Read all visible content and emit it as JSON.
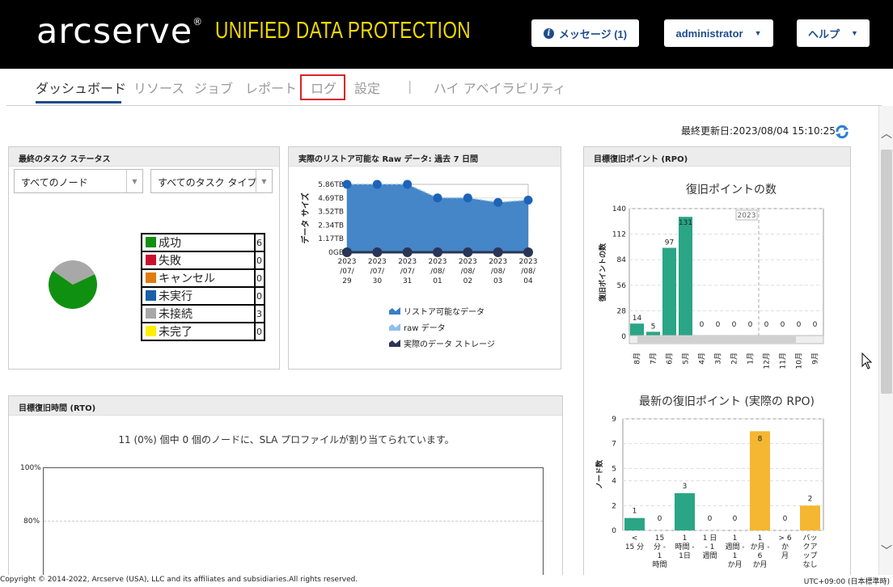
{
  "header": {
    "logo": "arcserve",
    "logo_mark": "®",
    "product": "UNIFIED DATA PROTECTION",
    "messages_label": "メッセージ (1)",
    "user_label": "administrator",
    "help_label": "ヘルプ",
    "colors": {
      "bar": "#000000",
      "product": "#f2d800",
      "button_text": "#1d4c8c"
    }
  },
  "nav": {
    "tabs": [
      {
        "label": "ダッシュボード",
        "active": true
      },
      {
        "label": "リソース"
      },
      {
        "label": "ジョブ"
      },
      {
        "label": "レポート"
      },
      {
        "label": "ログ",
        "highlighted": true
      },
      {
        "label": "設定"
      },
      {
        "label": "ハイ アベイラビリティ"
      }
    ],
    "separator": "|"
  },
  "last_updated": "最終更新日:2023/08/04 15:10:25",
  "task_status": {
    "title": "最終のタスク ステータス",
    "node_filter": "すべてのノード",
    "type_filter": "すべてのタスク タイプ",
    "legend": [
      {
        "label": "成功",
        "value": "6",
        "color": "#109010"
      },
      {
        "label": "失敗",
        "value": "0",
        "color": "#c8102e"
      },
      {
        "label": "キャンセル",
        "value": "0",
        "color": "#e07b10"
      },
      {
        "label": "未実行",
        "value": "0",
        "color": "#1a5fa8"
      },
      {
        "label": "未接続",
        "value": "3",
        "color": "#a8a8a8"
      },
      {
        "label": "未完了",
        "value": "0",
        "color": "#ffee00"
      }
    ]
  },
  "restore_data": {
    "title": "実際のリストア可能な Raw データ: 過去 7 日間",
    "ylabel": "データ サイズ",
    "legend": [
      {
        "label": "リストア可能なデータ",
        "color": "#3a7fc4"
      },
      {
        "label": "raw データ",
        "color": "#8fbfe8"
      },
      {
        "label": "実際のデータ ストレージ",
        "color": "#2b3555"
      }
    ]
  },
  "rto": {
    "title": "目標復旧時間 (RTO)",
    "message": "11 (0%) 個中 0 個のノードに、SLA プロファイルが割り当てられています。",
    "yticks": [
      "100%",
      "80%"
    ]
  },
  "rpo": {
    "title": "目標復旧ポイント (RPO)",
    "chart1_title": "復旧ポイントの数",
    "chart2_title": "最新の復旧ポイント (実際の RPO)"
  },
  "chart_data": [
    {
      "type": "pie",
      "categories": [
        "成功",
        "失敗",
        "キャンセル",
        "未実行",
        "未接続",
        "未完了"
      ],
      "values": [
        6,
        0,
        0,
        0,
        3,
        0
      ],
      "colors": [
        "#109010",
        "#c8102e",
        "#e07b10",
        "#1a5fa8",
        "#a8a8a8",
        "#ffee00"
      ]
    },
    {
      "type": "area",
      "title": "実際のリストア可能な Raw データ: 過去 7 日間",
      "ylabel": "データ サイズ",
      "x": [
        "2023/07/29",
        "2023/07/30",
        "2023/07/31",
        "2023/08/01",
        "2023/08/02",
        "2023/08/03",
        "2023/08/04"
      ],
      "yticks": [
        "0GB",
        "1.17TB",
        "2.34TB",
        "3.52TB",
        "4.69TB",
        "5.86TB"
      ],
      "ylim": [
        0,
        5.86
      ],
      "series": [
        {
          "name": "リストア可能なデータ",
          "values": [
            5.86,
            5.86,
            5.86,
            4.69,
            4.69,
            4.3,
            4.5
          ]
        },
        {
          "name": "raw データ",
          "values": [
            5.86,
            5.86,
            5.86,
            4.69,
            4.69,
            4.3,
            4.5
          ]
        },
        {
          "name": "実際のデータ ストレージ",
          "values": [
            0,
            0,
            0,
            0,
            0,
            0,
            0
          ]
        }
      ]
    },
    {
      "type": "bar",
      "title": "復旧ポイントの数",
      "ylabel": "復旧ポイントの数",
      "categories": [
        "8月",
        "7月",
        "6月",
        "5月",
        "4月",
        "3月",
        "2月",
        "1月",
        "12月",
        "11月",
        "10月",
        "9月"
      ],
      "values": [
        14,
        5,
        97,
        131,
        0,
        0,
        0,
        0,
        0,
        0,
        0,
        0
      ],
      "ylim": [
        0,
        140
      ],
      "yticks": [
        0,
        28,
        56,
        84,
        112,
        140
      ],
      "year_marker": "2023",
      "color": "#2aa586"
    },
    {
      "type": "bar",
      "title": "最新の復旧ポイント (実際の RPO)",
      "ylabel": "ノード数",
      "categories": [
        "< 15 分",
        "15 分 - 1 時間",
        "1 時間 - 1 日",
        "1 日 - 1 週間",
        "1 週間 - 1 か月",
        "1 か月 - 6 か月",
        "> 6 か月",
        "バックアップなし"
      ],
      "values": [
        1,
        0,
        3,
        0,
        0,
        8,
        0,
        2
      ],
      "ylim": [
        0,
        9
      ],
      "yticks": [
        0,
        2,
        4,
        5,
        7,
        9
      ],
      "colors": [
        "#2aa586",
        "#2aa586",
        "#2aa586",
        "#2aa586",
        "#2aa586",
        "#f5b731",
        "#f5b731",
        "#f5b731"
      ]
    }
  ],
  "footer": {
    "copyright": "Copyright © 2014-2022, Arcserve (USA), LLC and its affiliates and subsidiaries.All rights reserved.",
    "timezone": "UTC+09:00 (日本標準時)"
  }
}
